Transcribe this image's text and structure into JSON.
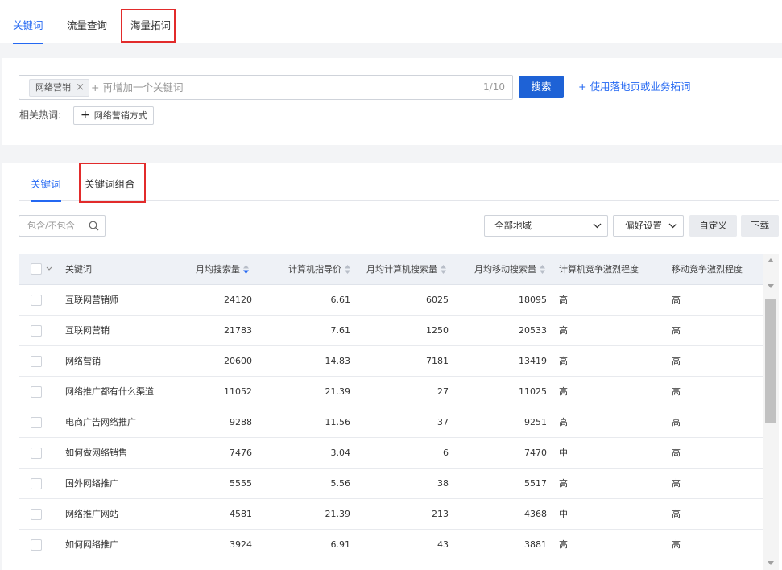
{
  "top_tabs": [
    {
      "label": "关键词",
      "active": true
    },
    {
      "label": "流量查询",
      "active": false
    },
    {
      "label": "海量拓词",
      "active": false
    }
  ],
  "search": {
    "tag": "网络营销",
    "add_placeholder": "+ 再增加一个关键词",
    "counter": "1/10",
    "button": "搜索",
    "landing_link": "+ 使用落地页或业务拓词",
    "hot_label": "相关热词:",
    "hot_chip": "网络营销方式"
  },
  "sub_tabs": [
    {
      "label": "关键词",
      "active": true
    },
    {
      "label": "关键词组合",
      "active": false
    }
  ],
  "toolbar": {
    "filter_placeholder": "包含/不包含",
    "region": "全部地域",
    "preference": "偏好设置",
    "customize": "自定义",
    "download": "下载"
  },
  "table": {
    "headers": [
      "关键词",
      "月均搜索量",
      "计算机指导价",
      "月均计算机搜索量",
      "月均移动搜索量",
      "计算机竞争激烈程度",
      "移动竞争激烈程度"
    ],
    "rows": [
      [
        "互联网营销师",
        "24120",
        "6.61",
        "6025",
        "18095",
        "高",
        "高"
      ],
      [
        "互联网营销",
        "21783",
        "7.61",
        "1250",
        "20533",
        "高",
        "高"
      ],
      [
        "网络营销",
        "20600",
        "14.83",
        "7181",
        "13419",
        "高",
        "高"
      ],
      [
        "网络推广都有什么渠道",
        "11052",
        "21.39",
        "27",
        "11025",
        "高",
        "高"
      ],
      [
        "电商广告网络推广",
        "9288",
        "11.56",
        "37",
        "9251",
        "高",
        "高"
      ],
      [
        "如何做网络销售",
        "7476",
        "3.04",
        "6",
        "7470",
        "中",
        "高"
      ],
      [
        "国外网络推广",
        "5555",
        "5.56",
        "38",
        "5517",
        "高",
        "高"
      ],
      [
        "网络推广网站",
        "4581",
        "21.39",
        "213",
        "4368",
        "中",
        "高"
      ],
      [
        "如何网络推广",
        "3924",
        "6.91",
        "43",
        "3881",
        "高",
        "高"
      ]
    ]
  },
  "colors": {
    "accent": "#2468f2",
    "highlight_box": "#e22b2b",
    "search_button": "#1e62d6"
  }
}
